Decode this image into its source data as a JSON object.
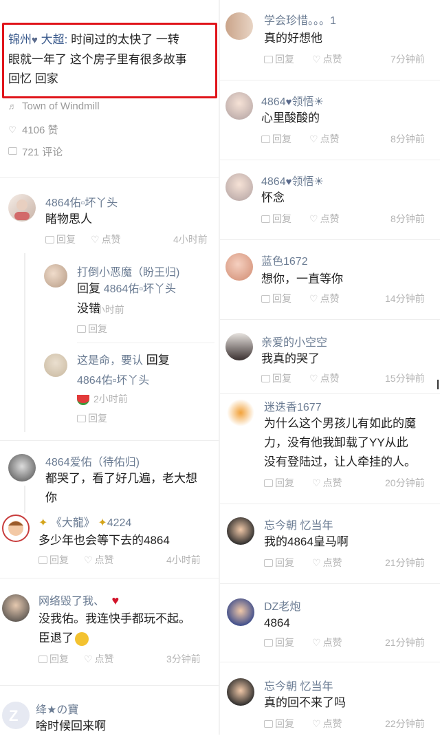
{
  "post": {
    "author": "锦州",
    "author_suffix": "大超:",
    "text_line1": "时间过的太快了 一转",
    "text_line2": "眼就一年了 这个房子里有很多故事",
    "text_line3": "回忆 回家",
    "music": "Town of Windmill",
    "likes": "4106 赞",
    "comments": "721 评论"
  },
  "left_comments": [
    {
      "name": "4864佑▫坏丫头",
      "text": "睹物思人",
      "reply": "回复",
      "like": "点赞",
      "time": "4小时前"
    },
    {
      "name": "打倒小恶魔（盼王归)",
      "text1_prefix": "回复",
      "text1": "4864佑▫坏丫头",
      "text2": "没错",
      "time": "4小时前",
      "reply": "回复"
    },
    {
      "name": "这是命，要认",
      "name_reply": "回复",
      "text": "4864佑▫坏丫头",
      "time": "2小时前",
      "reply": "回复"
    },
    {
      "name": "4864爱佑（待佑归)",
      "text1": "都哭了，看了好几遍，老大想",
      "text2": "你"
    },
    {
      "name_a": "《大龍》",
      "name_b": "4224",
      "text": "多少年也会等下去的4864",
      "reply": "回复",
      "like": "点赞",
      "time": "4小时前"
    },
    {
      "name": "网络毁了我、",
      "text1": "没我佑。我连快手都玩不起。",
      "text2": "臣退了",
      "reply": "回复",
      "like": "点赞",
      "time": "3分钟前"
    },
    {
      "name": "绛★の寶",
      "text": "啥时候回来啊"
    }
  ],
  "right_comments": [
    {
      "name": "学会珍惜。。。1",
      "text": "真的好想他",
      "reply": "回复",
      "like": "点赞",
      "time": "7分钟前"
    },
    {
      "name": "4864",
      "name_b": "领悟☀",
      "text": "心里酸酸的",
      "reply": "回复",
      "like": "点赞",
      "time": "8分钟前"
    },
    {
      "name": "4864",
      "name_b": "领悟☀",
      "text": "怀念",
      "reply": "回复",
      "like": "点赞",
      "time": "8分钟前"
    },
    {
      "name": "蓝色1672",
      "text": "想你，一直等你",
      "reply": "回复",
      "like": "点赞",
      "time": "14分钟前"
    },
    {
      "name": "亲爱的小空空",
      "text": "我真的哭了",
      "reply": "回复",
      "like": "点赞",
      "time": "15分钟前"
    },
    {
      "name": "迷迭香1677",
      "text1": "为什么这个男孩儿有如此的魔",
      "text2": "力，没有他我卸载了YY从此",
      "text3": "没有登陆过，让人牵挂的人。",
      "reply": "回复",
      "like": "点赞",
      "time": "20分钟前"
    },
    {
      "name": "忘今朝 忆当年",
      "text": "我的4864皇马啊",
      "reply": "回复",
      "like": "点赞",
      "time": "21分钟前"
    },
    {
      "name": "DZ老炮",
      "text": "4864",
      "reply": "回复",
      "like": "点赞",
      "time": "21分钟前"
    },
    {
      "name": "忘今朝 忆当年",
      "text": "真的回不来了吗",
      "reply": "回复",
      "like": "点赞",
      "time": "22分钟前"
    }
  ],
  "colors": {
    "highlight": "#e0141a",
    "name": "#6b7c93",
    "muted": "#b4b4b4"
  }
}
